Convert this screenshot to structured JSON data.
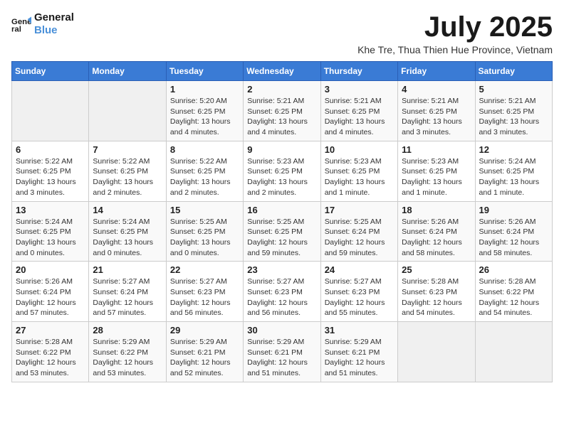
{
  "header": {
    "logo_line1": "General",
    "logo_line2": "Blue",
    "month_title": "July 2025",
    "location": "Khe Tre, Thua Thien Hue Province, Vietnam"
  },
  "weekdays": [
    "Sunday",
    "Monday",
    "Tuesday",
    "Wednesday",
    "Thursday",
    "Friday",
    "Saturday"
  ],
  "weeks": [
    [
      {
        "day": "",
        "info": ""
      },
      {
        "day": "",
        "info": ""
      },
      {
        "day": "1",
        "info": "Sunrise: 5:20 AM\nSunset: 6:25 PM\nDaylight: 13 hours and 4 minutes."
      },
      {
        "day": "2",
        "info": "Sunrise: 5:21 AM\nSunset: 6:25 PM\nDaylight: 13 hours and 4 minutes."
      },
      {
        "day": "3",
        "info": "Sunrise: 5:21 AM\nSunset: 6:25 PM\nDaylight: 13 hours and 4 minutes."
      },
      {
        "day": "4",
        "info": "Sunrise: 5:21 AM\nSunset: 6:25 PM\nDaylight: 13 hours and 3 minutes."
      },
      {
        "day": "5",
        "info": "Sunrise: 5:21 AM\nSunset: 6:25 PM\nDaylight: 13 hours and 3 minutes."
      }
    ],
    [
      {
        "day": "6",
        "info": "Sunrise: 5:22 AM\nSunset: 6:25 PM\nDaylight: 13 hours and 3 minutes."
      },
      {
        "day": "7",
        "info": "Sunrise: 5:22 AM\nSunset: 6:25 PM\nDaylight: 13 hours and 2 minutes."
      },
      {
        "day": "8",
        "info": "Sunrise: 5:22 AM\nSunset: 6:25 PM\nDaylight: 13 hours and 2 minutes."
      },
      {
        "day": "9",
        "info": "Sunrise: 5:23 AM\nSunset: 6:25 PM\nDaylight: 13 hours and 2 minutes."
      },
      {
        "day": "10",
        "info": "Sunrise: 5:23 AM\nSunset: 6:25 PM\nDaylight: 13 hours and 1 minute."
      },
      {
        "day": "11",
        "info": "Sunrise: 5:23 AM\nSunset: 6:25 PM\nDaylight: 13 hours and 1 minute."
      },
      {
        "day": "12",
        "info": "Sunrise: 5:24 AM\nSunset: 6:25 PM\nDaylight: 13 hours and 1 minute."
      }
    ],
    [
      {
        "day": "13",
        "info": "Sunrise: 5:24 AM\nSunset: 6:25 PM\nDaylight: 13 hours and 0 minutes."
      },
      {
        "day": "14",
        "info": "Sunrise: 5:24 AM\nSunset: 6:25 PM\nDaylight: 13 hours and 0 minutes."
      },
      {
        "day": "15",
        "info": "Sunrise: 5:25 AM\nSunset: 6:25 PM\nDaylight: 13 hours and 0 minutes."
      },
      {
        "day": "16",
        "info": "Sunrise: 5:25 AM\nSunset: 6:25 PM\nDaylight: 12 hours and 59 minutes."
      },
      {
        "day": "17",
        "info": "Sunrise: 5:25 AM\nSunset: 6:24 PM\nDaylight: 12 hours and 59 minutes."
      },
      {
        "day": "18",
        "info": "Sunrise: 5:26 AM\nSunset: 6:24 PM\nDaylight: 12 hours and 58 minutes."
      },
      {
        "day": "19",
        "info": "Sunrise: 5:26 AM\nSunset: 6:24 PM\nDaylight: 12 hours and 58 minutes."
      }
    ],
    [
      {
        "day": "20",
        "info": "Sunrise: 5:26 AM\nSunset: 6:24 PM\nDaylight: 12 hours and 57 minutes."
      },
      {
        "day": "21",
        "info": "Sunrise: 5:27 AM\nSunset: 6:24 PM\nDaylight: 12 hours and 57 minutes."
      },
      {
        "day": "22",
        "info": "Sunrise: 5:27 AM\nSunset: 6:23 PM\nDaylight: 12 hours and 56 minutes."
      },
      {
        "day": "23",
        "info": "Sunrise: 5:27 AM\nSunset: 6:23 PM\nDaylight: 12 hours and 56 minutes."
      },
      {
        "day": "24",
        "info": "Sunrise: 5:27 AM\nSunset: 6:23 PM\nDaylight: 12 hours and 55 minutes."
      },
      {
        "day": "25",
        "info": "Sunrise: 5:28 AM\nSunset: 6:23 PM\nDaylight: 12 hours and 54 minutes."
      },
      {
        "day": "26",
        "info": "Sunrise: 5:28 AM\nSunset: 6:22 PM\nDaylight: 12 hours and 54 minutes."
      }
    ],
    [
      {
        "day": "27",
        "info": "Sunrise: 5:28 AM\nSunset: 6:22 PM\nDaylight: 12 hours and 53 minutes."
      },
      {
        "day": "28",
        "info": "Sunrise: 5:29 AM\nSunset: 6:22 PM\nDaylight: 12 hours and 53 minutes."
      },
      {
        "day": "29",
        "info": "Sunrise: 5:29 AM\nSunset: 6:21 PM\nDaylight: 12 hours and 52 minutes."
      },
      {
        "day": "30",
        "info": "Sunrise: 5:29 AM\nSunset: 6:21 PM\nDaylight: 12 hours and 51 minutes."
      },
      {
        "day": "31",
        "info": "Sunrise: 5:29 AM\nSunset: 6:21 PM\nDaylight: 12 hours and 51 minutes."
      },
      {
        "day": "",
        "info": ""
      },
      {
        "day": "",
        "info": ""
      }
    ]
  ]
}
